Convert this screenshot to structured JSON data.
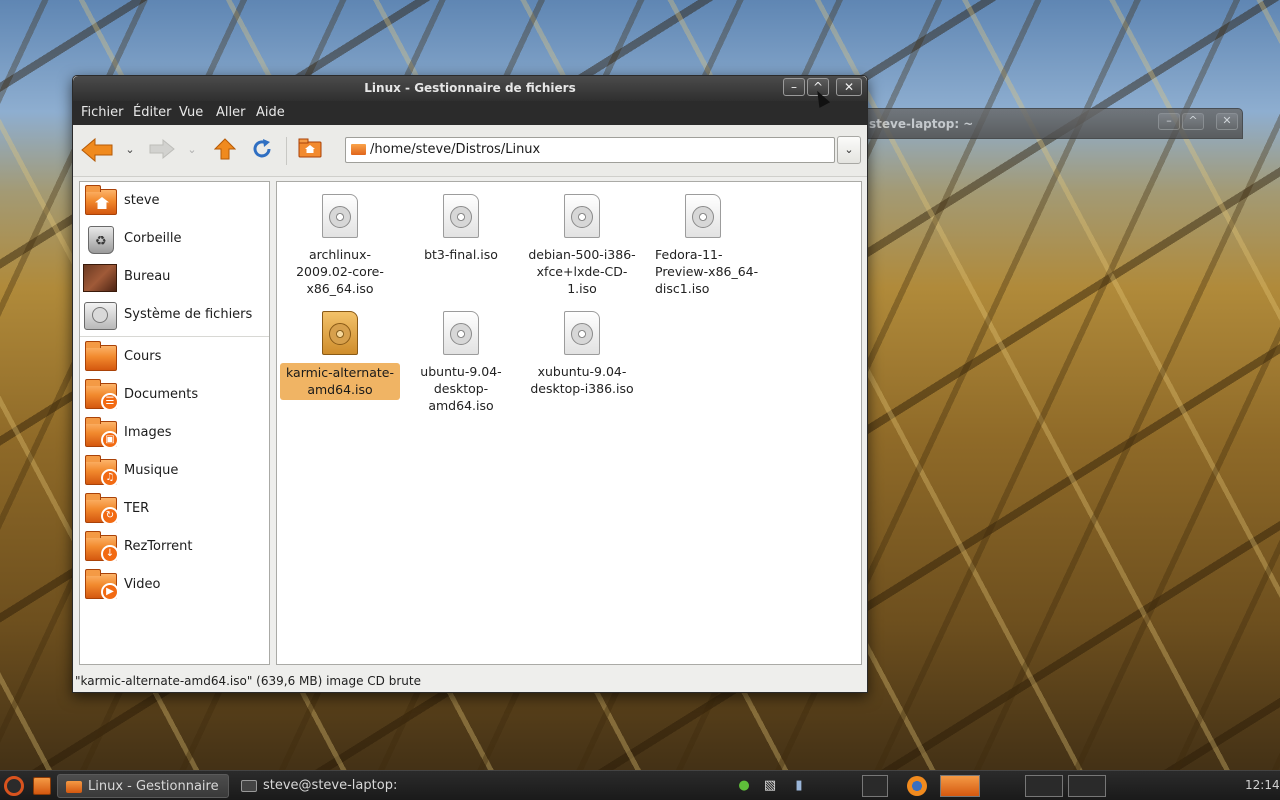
{
  "background_window": {
    "title": "steve-laptop: ~",
    "buttons": [
      "–",
      "^",
      "✕"
    ]
  },
  "window": {
    "title": "Linux - Gestionnaire de fichiers",
    "wm_buttons": {
      "minimize": "–",
      "maximize": "^",
      "close": "✕"
    }
  },
  "menubar": [
    {
      "label": "Fichier"
    },
    {
      "label": "Éditer"
    },
    {
      "label": "Vue"
    },
    {
      "label": "Aller"
    },
    {
      "label": "Aide"
    }
  ],
  "toolbar": {
    "dropdown_glyph": "⌄",
    "location": "/home/steve/Distros/Linux"
  },
  "sidebar": {
    "places": [
      {
        "label": "steve",
        "icon": "home-icon"
      },
      {
        "label": "Corbeille",
        "icon": "trash-icon"
      },
      {
        "label": "Bureau",
        "icon": "desktop-icon"
      },
      {
        "label": "Système de fichiers",
        "icon": "harddisk-icon"
      }
    ],
    "bookmarks": [
      {
        "label": "Cours",
        "icon": "folder-icon"
      },
      {
        "label": "Documents",
        "icon": "documents-folder-icon"
      },
      {
        "label": "Images",
        "icon": "pictures-folder-icon"
      },
      {
        "label": "Musique",
        "icon": "music-folder-icon"
      },
      {
        "label": "TER",
        "icon": "folder-icon"
      },
      {
        "label": "RezTorrent",
        "icon": "folder-icon"
      },
      {
        "label": "Video",
        "icon": "video-folder-icon"
      }
    ]
  },
  "files": [
    {
      "name": "archlinux-2009.02-core-x86_64.iso",
      "selected": false
    },
    {
      "name": "bt3-final.iso",
      "selected": false
    },
    {
      "name": "debian-500-i386-xfce+lxde-CD-1.iso",
      "selected": false
    },
    {
      "name": "Fedora-11-Preview-x86_64-disc1.iso",
      "selected": false
    },
    {
      "name": "karmic-alternate-amd64.iso",
      "selected": true
    },
    {
      "name": "ubuntu-9.04-desktop-amd64.iso",
      "selected": false
    },
    {
      "name": "xubuntu-9.04-desktop-i386.iso",
      "selected": false
    }
  ],
  "statusbar": {
    "text": "\"karmic-alternate-amd64.iso\" (639,6 MB) image CD brute"
  },
  "panel": {
    "tasks": [
      {
        "label": "Linux - Gestionnaire ...",
        "active": true
      },
      {
        "label": "steve@steve-laptop: ~",
        "active": false
      }
    ],
    "clock": "12:14"
  },
  "colors": {
    "accent_orange": "#f28a2e",
    "selection": "#f0b464",
    "titlebar": "#3a3a3a",
    "menubar": "#2b2b2b"
  }
}
